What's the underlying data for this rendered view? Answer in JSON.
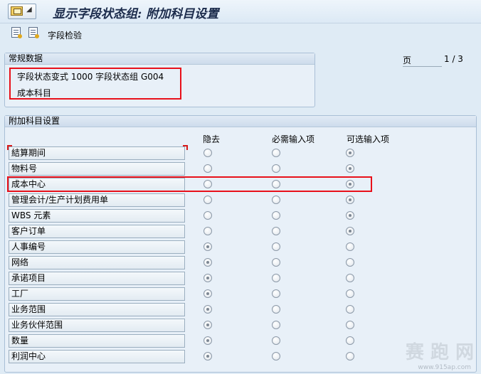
{
  "window": {
    "title": "显示字段状态组: 附加科目设置"
  },
  "toolbar": {
    "check_label": "字段检验"
  },
  "general": {
    "header": "常规数据",
    "line1": "字段状态变式 1000  字段状态组 G004",
    "line2": "成本科目"
  },
  "pager": {
    "label": "页",
    "value": "1 / 3"
  },
  "fields_group": {
    "header": "附加科目设置",
    "columns": [
      "隐去",
      "必需输入项",
      "可选输入项"
    ],
    "rows": [
      {
        "label": "結算期间",
        "selected": 2
      },
      {
        "label": "物料号",
        "selected": 2
      },
      {
        "label": "成本中心",
        "selected": 2
      },
      {
        "label": "管理会计/生产计划费用单",
        "selected": 2
      },
      {
        "label": "WBS 元素",
        "selected": 2
      },
      {
        "label": "客户订单",
        "selected": 2
      },
      {
        "label": "人事编号",
        "selected": 0
      },
      {
        "label": "网络",
        "selected": 0
      },
      {
        "label": "承诺项目",
        "selected": 0
      },
      {
        "label": "工厂",
        "selected": 0
      },
      {
        "label": "业务范围",
        "selected": 0
      },
      {
        "label": "业务伙伴范围",
        "selected": 0
      },
      {
        "label": "数量",
        "selected": 0
      },
      {
        "label": "利润中心",
        "selected": 0
      }
    ]
  },
  "colors": {
    "highlight": "#e8101a",
    "background": "#dfebf5"
  }
}
